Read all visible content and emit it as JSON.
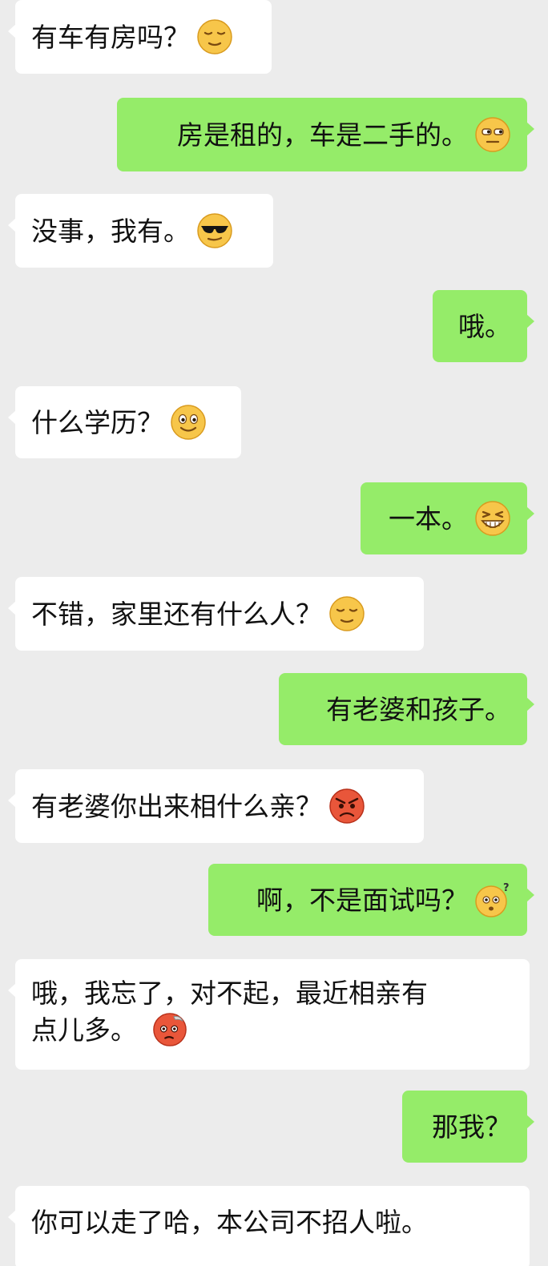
{
  "messages": [
    {
      "id": "m1",
      "side": "in",
      "text": "有车有房吗？",
      "emoji": "smug-closed-eyes-emoji"
    },
    {
      "id": "m2",
      "side": "out",
      "text": "房是租的，车是二手的。",
      "emoji": "side-eye-emoji"
    },
    {
      "id": "m3",
      "side": "in",
      "text": "没事，我有。",
      "emoji": "sunglasses-emoji"
    },
    {
      "id": "m4",
      "side": "out",
      "text": "哦。",
      "emoji": ""
    },
    {
      "id": "m5",
      "side": "in",
      "text": "什么学历？",
      "emoji": "smile-emoji"
    },
    {
      "id": "m6",
      "side": "out",
      "text": "一本。",
      "emoji": "grin-emoji"
    },
    {
      "id": "m7",
      "side": "in",
      "text": "不错，家里还有什么人？",
      "emoji": "smug-closed-eyes-emoji"
    },
    {
      "id": "m8",
      "side": "out",
      "text": "有老婆和孩子。",
      "emoji": ""
    },
    {
      "id": "m9",
      "side": "in",
      "text": "有老婆你出来相什么亲？",
      "emoji": "angry-emoji"
    },
    {
      "id": "m10",
      "side": "out",
      "text": "啊，不是面试吗？",
      "emoji": "confused-question-emoji"
    },
    {
      "id": "m11",
      "side": "in",
      "line1": "哦，我忘了，对不起，最近相亲有",
      "line2": "点儿多。",
      "emoji": "embarrassed-emoji"
    },
    {
      "id": "m12",
      "side": "out",
      "text": "那我？",
      "emoji": ""
    },
    {
      "id": "m13",
      "side": "in",
      "text": "你可以走了哈，本公司不招人啦。",
      "emoji": ""
    }
  ]
}
